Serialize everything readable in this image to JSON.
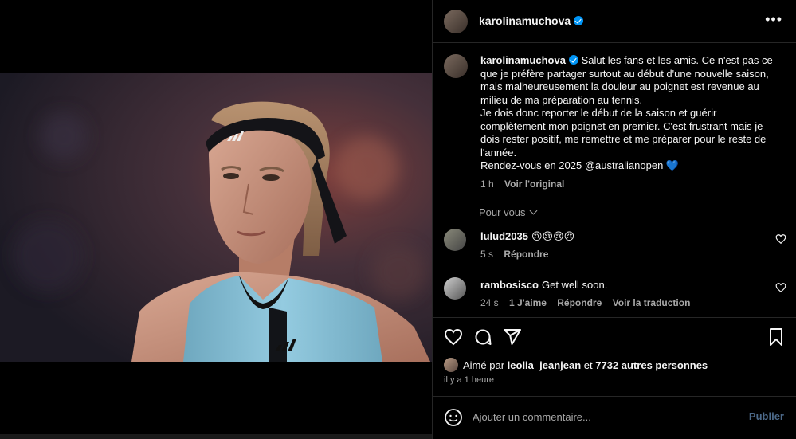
{
  "post": {
    "username": "karolinamuchova",
    "more_glyph": "•••"
  },
  "caption": {
    "username": "karolinamuchova",
    "lines": [
      "Salut les fans et les amis. Ce n'est pas ce que je préfère partager surtout au début d'une nouvelle saison, mais malheureusement la douleur au poignet est revenue au milieu de ma préparation au tennis.",
      "Je dois donc reporter le début de la saison et guérir complètement mon poignet en premier. C'est frustrant mais je dois rester positif, me remettre et me préparer pour le reste de l'année.",
      "Rendez-vous en 2025 @australianopen 💙"
    ],
    "time": "1 h",
    "see_original": "Voir l'original"
  },
  "see_translation_toggle": "Pour vous",
  "comments": [
    {
      "username": "lulud2035",
      "text": "😢😢😢😢",
      "time": "5 s",
      "likes": "",
      "reply": "Répondre",
      "translate": ""
    },
    {
      "username": "rambosisco",
      "text": "Get well soon.",
      "time": "24 s",
      "likes": "1 J'aime",
      "reply": "Répondre",
      "translate": "Voir la traduction"
    }
  ],
  "icons": {
    "like": "heart-icon",
    "comment": "comment-icon",
    "share": "send-icon",
    "save": "bookmark-icon",
    "emoji": "smiley-icon"
  },
  "likes_line": {
    "prefix": "Aimé par",
    "user": "leolia_jeanjean",
    "middle": "et",
    "others": "7732 autres personnes"
  },
  "timestamp": "il y a 1 heure",
  "composer": {
    "placeholder": "Ajouter un commentaire...",
    "publish_label": "Publier"
  },
  "colors": {
    "background": "#000000",
    "text": "#f5f5f5",
    "secondary": "#a8a8a8",
    "divider": "#262626",
    "verified": "#0095f6",
    "publish_disabled": "#4d6a8a",
    "shirt": "#8ec3d8"
  }
}
